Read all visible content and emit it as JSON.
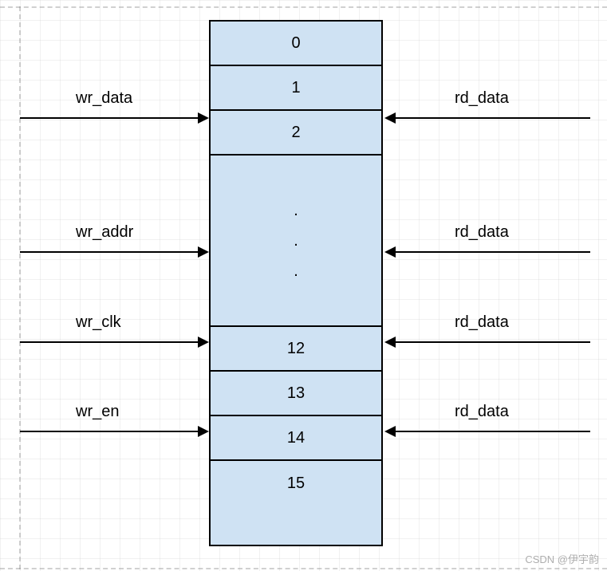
{
  "memory": {
    "cells_top": [
      "0",
      "1",
      "2"
    ],
    "cells_bottom": [
      "12",
      "13",
      "14",
      "15"
    ],
    "ellipsis_dots": [
      ".",
      ".",
      "."
    ]
  },
  "left_signals": {
    "wr_data": "wr_data",
    "wr_addr": "wr_addr",
    "wr_clk": "wr_clk",
    "wr_en": "wr_en"
  },
  "right_signals": {
    "rd_data_1": "rd_data",
    "rd_data_2": "rd_data",
    "rd_data_3": "rd_data",
    "rd_data_4": "rd_data"
  },
  "watermark": "CSDN @伊宇韵"
}
